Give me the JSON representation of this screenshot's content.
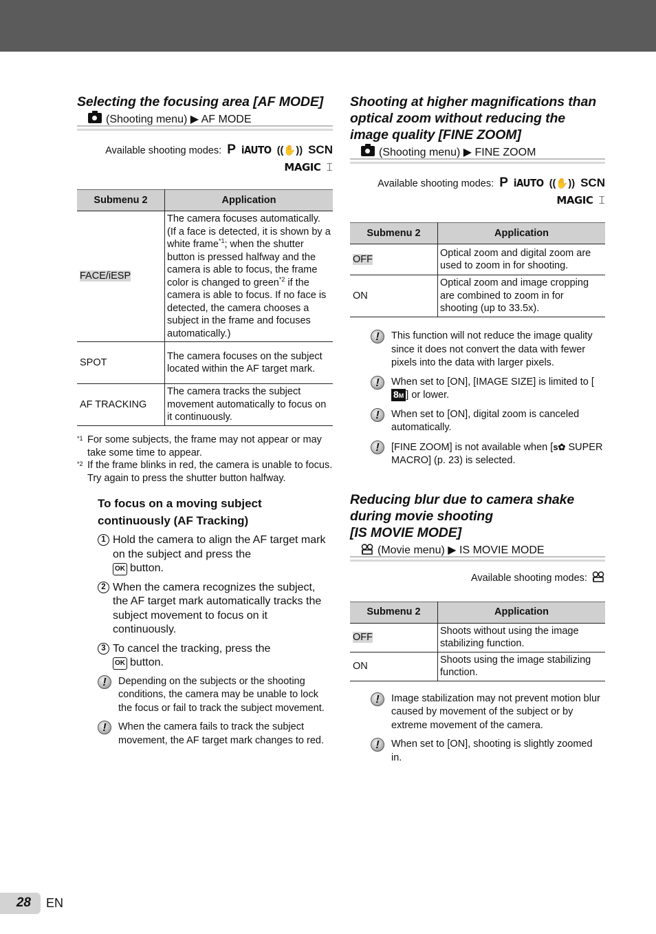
{
  "page": {
    "number": "28",
    "language": "EN"
  },
  "left": {
    "section": {
      "title": "Selecting the focusing area [AF MODE]",
      "menu_path": {
        "icon": "camera-icon",
        "menu": "(Shooting menu)",
        "arrow": "▶",
        "item": "AF MODE"
      },
      "modes_label": "Available shooting modes:",
      "modes": [
        "P",
        "iAUTO",
        "((✋))",
        "SCN",
        "MAGIC",
        "⌶"
      ],
      "table": {
        "headers": [
          "Submenu 2",
          "Application"
        ],
        "rows": [
          {
            "submenu": "FACE/iESP",
            "default": true,
            "application_parts": [
              "The camera focuses automatically. (If a face is detected, it is shown by a white frame",
              "*1",
              "; when the shutter button is pressed halfway and the camera is able to focus, the frame color is changed to green",
              "*2",
              " if the camera is able to focus. If no face is detected, the camera chooses a subject in the frame and focuses automatically.)"
            ]
          },
          {
            "submenu": "SPOT",
            "default": false,
            "application": "The camera focuses on the subject located within the AF target mark."
          },
          {
            "submenu": "AF TRACKING",
            "default": false,
            "application": "The camera tracks the subject movement automatically to focus on it continuously."
          }
        ]
      },
      "footnotes": [
        {
          "mark": "*1",
          "text": "For some subjects, the frame may not appear or may take some time to appear."
        },
        {
          "mark": "*2",
          "text": "If the frame blinks in red, the camera is unable to focus. Try again to press the shutter button halfway."
        }
      ]
    },
    "subsection": {
      "title": "To focus on a moving subject continuously (AF Tracking)",
      "steps": [
        {
          "num": "1",
          "text": "Hold the camera to align the AF target mark on the subject and press the",
          "button": "OK",
          "after": "button."
        },
        {
          "num": "2",
          "text": "When the camera recognizes the subject, the AF target mark automatically tracks the subject movement to focus on it continuously."
        },
        {
          "num": "3",
          "text": "To cancel the tracking, press the",
          "button": "OK",
          "after": "button."
        }
      ],
      "notes": [
        "Depending on the subjects or the shooting conditions, the camera may be unable to lock the focus or fail to track the subject movement.",
        "When the camera fails to track the subject movement, the AF target mark changes to red."
      ]
    }
  },
  "right": {
    "finezoom": {
      "title": "Shooting at higher magnifications than optical zoom without reducing the image quality [FINE ZOOM]",
      "menu_path": {
        "icon": "camera-icon",
        "menu": "(Shooting menu)",
        "arrow": "▶",
        "item": "FINE ZOOM"
      },
      "modes_label": "Available shooting modes:",
      "modes": [
        "P",
        "iAUTO",
        "((✋))",
        "SCN",
        "MAGIC",
        "⌶"
      ],
      "table": {
        "headers": [
          "Submenu 2",
          "Application"
        ],
        "rows": [
          {
            "submenu": "OFF",
            "default": true,
            "application": "Optical zoom and digital zoom are used to zoom in for shooting."
          },
          {
            "submenu": "ON",
            "default": false,
            "application": "Optical zoom and image cropping are combined to zoom in for shooting (up to 33.5x)."
          }
        ]
      },
      "notes": [
        {
          "text": "This function will not reduce the image quality since it does not convert the data with fewer pixels into the data with larger pixels."
        },
        {
          "before": "When set to [ON], [IMAGE SIZE] is limited to [",
          "icon": "8",
          "icon_sub": "M",
          "after": "] or lower."
        },
        {
          "text": "When set to [ON], digital zoom is canceled automatically."
        },
        {
          "before": "[FINE ZOOM] is not available when [",
          "icon": "s✿",
          "after": " SUPER MACRO] (p. 23) is selected."
        }
      ]
    },
    "ismovie": {
      "title": "Reducing blur due to camera shake during movie shooting [IS MOVIE MODE]",
      "title_lines": [
        "Reducing blur due to camera shake",
        "during movie shooting",
        "[IS MOVIE MODE]"
      ],
      "menu_path": {
        "icon": "movie-icon",
        "menu": "(Movie menu)",
        "arrow": "▶",
        "item": "IS MOVIE MODE"
      },
      "modes_label": "Available shooting modes:",
      "table": {
        "headers": [
          "Submenu 2",
          "Application"
        ],
        "rows": [
          {
            "submenu": "OFF",
            "default": true,
            "application": "Shoots without using the image stabilizing function."
          },
          {
            "submenu": "ON",
            "default": false,
            "application": "Shoots using the image stabilizing function."
          }
        ]
      },
      "notes": [
        "Image stabilization may not prevent motion blur caused by movement of the subject or by extreme movement of the camera.",
        "When set to [ON], shooting is slightly zoomed in."
      ]
    }
  }
}
